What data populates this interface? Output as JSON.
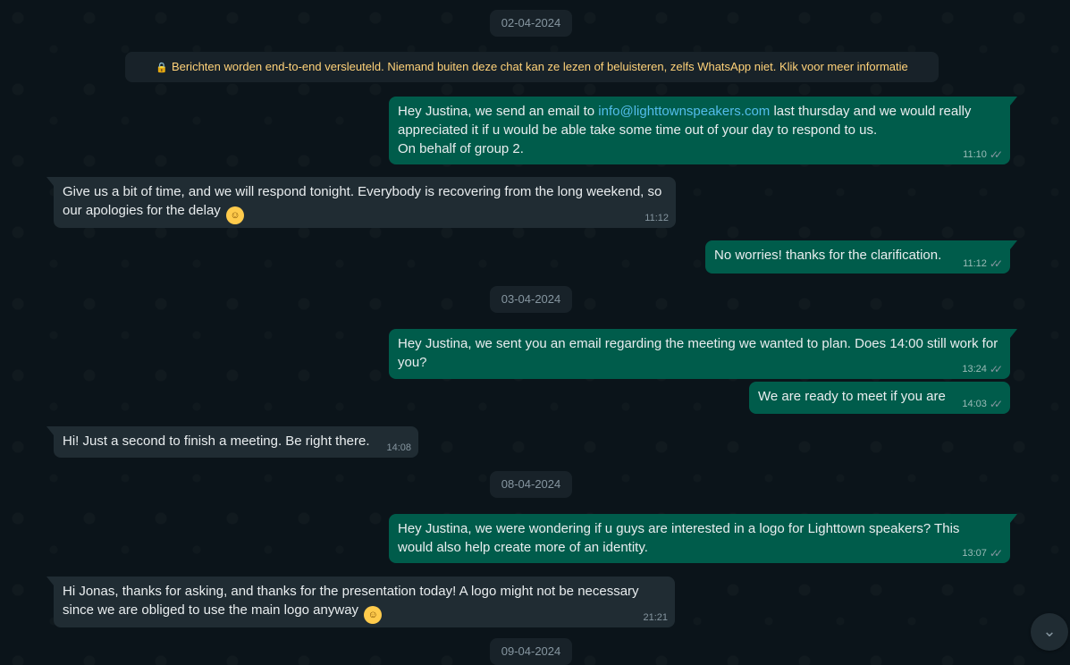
{
  "dates": {
    "d1": "02-04-2024",
    "d2": "03-04-2024",
    "d3": "08-04-2024",
    "d4": "09-04-2024"
  },
  "encryption_notice": "Berichten worden end-to-end versleuteld. Niemand buiten deze chat kan ze lezen of beluisteren, zelfs WhatsApp niet. Klik voor meer informatie",
  "messages": [
    {
      "direction": "out",
      "text_before": "Hey Justina, we send an email to ",
      "link": "info@lighttownspeakers.com",
      "text_after": " last thursday and we would really appreciated it if u would be able take some time out of your day to respond to us.",
      "text_line3": "On behalf of group 2.",
      "time": "11:10",
      "status": "read"
    },
    {
      "direction": "in",
      "text": "Give us a bit of time, and we will respond tonight. Everybody is recovering from the long weekend, so our apologies for the delay",
      "emoji": "relieved-face",
      "time": "11:12"
    },
    {
      "direction": "out",
      "text": "No worries! thanks for the clarification.",
      "time": "11:12",
      "status": "read"
    },
    {
      "direction": "out",
      "text": "Hey Justina, we sent you an email regarding the meeting we wanted to plan. Does 14:00 still work for you?",
      "time": "13:24",
      "status": "read"
    },
    {
      "direction": "out",
      "text": "We are ready to meet if you are",
      "time": "14:03",
      "status": "read"
    },
    {
      "direction": "in",
      "text": "Hi! Just a second to finish a meeting. Be right there.",
      "time": "14:08"
    },
    {
      "direction": "out",
      "text": "Hey Justina, we were wondering if u guys are interested in a logo for Lighttown speakers? This would also help create more of an identity.",
      "time": "13:07",
      "status": "read"
    },
    {
      "direction": "in",
      "text": "Hi Jonas, thanks for asking, and thanks for the presentation today! A logo might not be necessary since we are obliged to use the main logo anyway",
      "emoji": "relieved-face",
      "time": "21:21"
    }
  ],
  "colors": {
    "background": "#0b141a",
    "outgoing_bubble": "#005c4b",
    "incoming_bubble": "#202c33",
    "notice_text": "#ffd279",
    "link": "#53bdeb"
  },
  "icons": [
    "lock-icon",
    "double-check-icon",
    "chevron-down-icon",
    "relieved-face-emoji"
  ]
}
